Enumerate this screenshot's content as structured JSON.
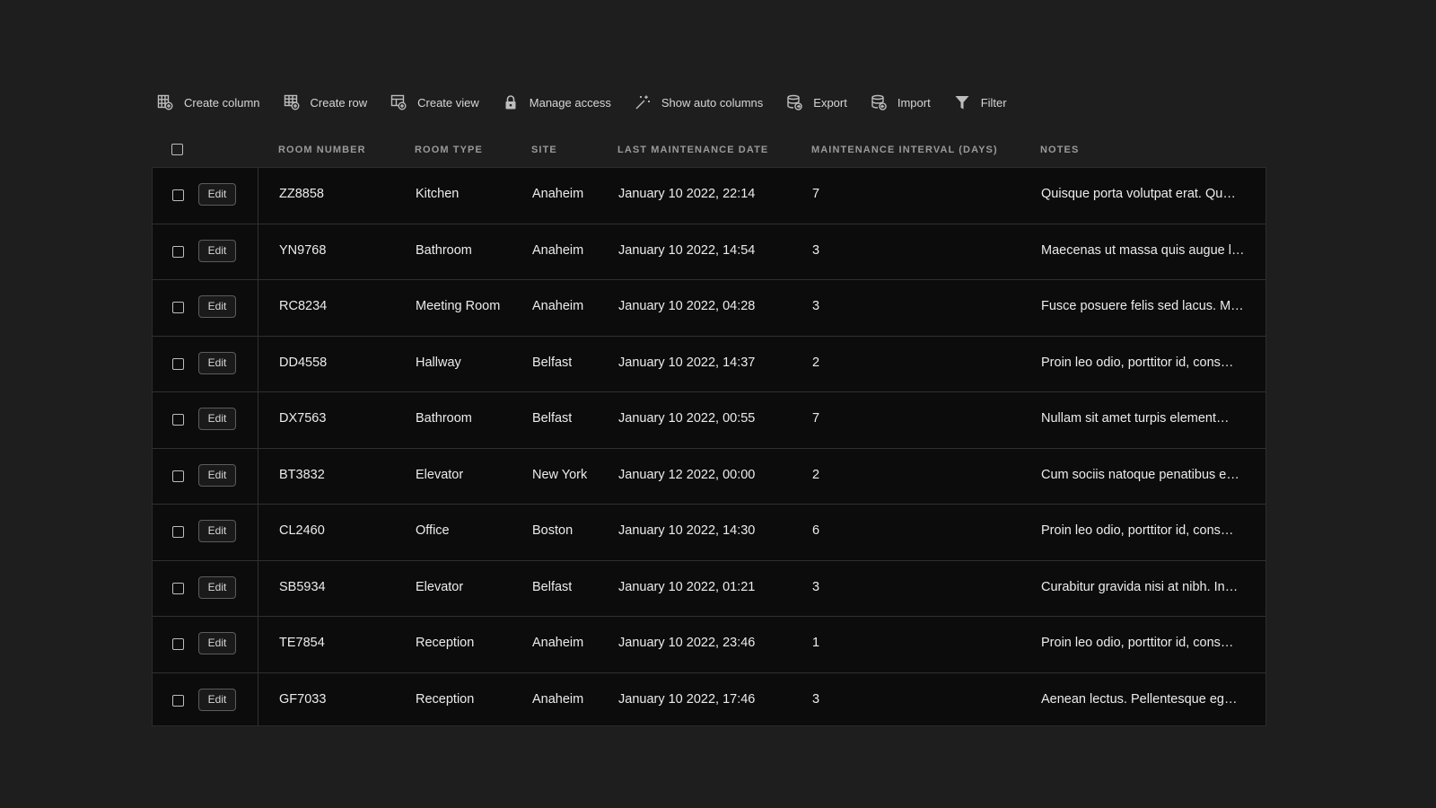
{
  "toolbar": {
    "items": [
      {
        "label": "Create column",
        "icon": "create-column-icon"
      },
      {
        "label": "Create row",
        "icon": "create-row-icon"
      },
      {
        "label": "Create view",
        "icon": "create-view-icon"
      },
      {
        "label": "Manage access",
        "icon": "lock-icon"
      },
      {
        "label": "Show auto columns",
        "icon": "magic-wand-icon"
      },
      {
        "label": "Export",
        "icon": "database-export-icon"
      },
      {
        "label": "Import",
        "icon": "database-import-icon"
      },
      {
        "label": "Filter",
        "icon": "filter-icon"
      }
    ]
  },
  "table": {
    "columns": [
      "ROOM NUMBER",
      "ROOM TYPE",
      "SITE",
      "LAST MAINTENANCE DATE",
      "MAINTENANCE INTERVAL (DAYS)",
      "NOTES"
    ],
    "edit_label": "Edit",
    "rows": [
      {
        "room": "ZZ8858",
        "type": "Kitchen",
        "site": "Anaheim",
        "date": "January 10 2022, 22:14",
        "interval": "7",
        "notes": "Quisque porta volutpat erat. Qu…"
      },
      {
        "room": "YN9768",
        "type": "Bathroom",
        "site": "Anaheim",
        "date": "January 10 2022, 14:54",
        "interval": "3",
        "notes": "Maecenas ut massa quis augue l…"
      },
      {
        "room": "RC8234",
        "type": "Meeting Room",
        "site": "Anaheim",
        "date": "January 10 2022, 04:28",
        "interval": "3",
        "notes": "Fusce posuere felis sed lacus. M…"
      },
      {
        "room": "DD4558",
        "type": "Hallway",
        "site": "Belfast",
        "date": "January 10 2022, 14:37",
        "interval": "2",
        "notes": "Proin leo odio, porttitor id, cons…"
      },
      {
        "room": "DX7563",
        "type": "Bathroom",
        "site": "Belfast",
        "date": "January 10 2022, 00:55",
        "interval": "7",
        "notes": "Nullam sit amet turpis element…"
      },
      {
        "room": "BT3832",
        "type": "Elevator",
        "site": "New York",
        "date": "January 12 2022, 00:00",
        "interval": "2",
        "notes": "Cum sociis natoque penatibus e…"
      },
      {
        "room": "CL2460",
        "type": "Office",
        "site": "Boston",
        "date": "January 10 2022, 14:30",
        "interval": "6",
        "notes": "Proin leo odio, porttitor id, cons…"
      },
      {
        "room": "SB5934",
        "type": "Elevator",
        "site": "Belfast",
        "date": "January 10 2022, 01:21",
        "interval": "3",
        "notes": "Curabitur gravida nisi at nibh. In…"
      },
      {
        "room": "TE7854",
        "type": "Reception",
        "site": "Anaheim",
        "date": "January 10 2022, 23:46",
        "interval": "1",
        "notes": "Proin leo odio, porttitor id, cons…"
      },
      {
        "room": "GF7033",
        "type": "Reception",
        "site": "Anaheim",
        "date": "January 10 2022, 17:46",
        "interval": "3",
        "notes": "Aenean lectus. Pellentesque eg…"
      }
    ]
  }
}
